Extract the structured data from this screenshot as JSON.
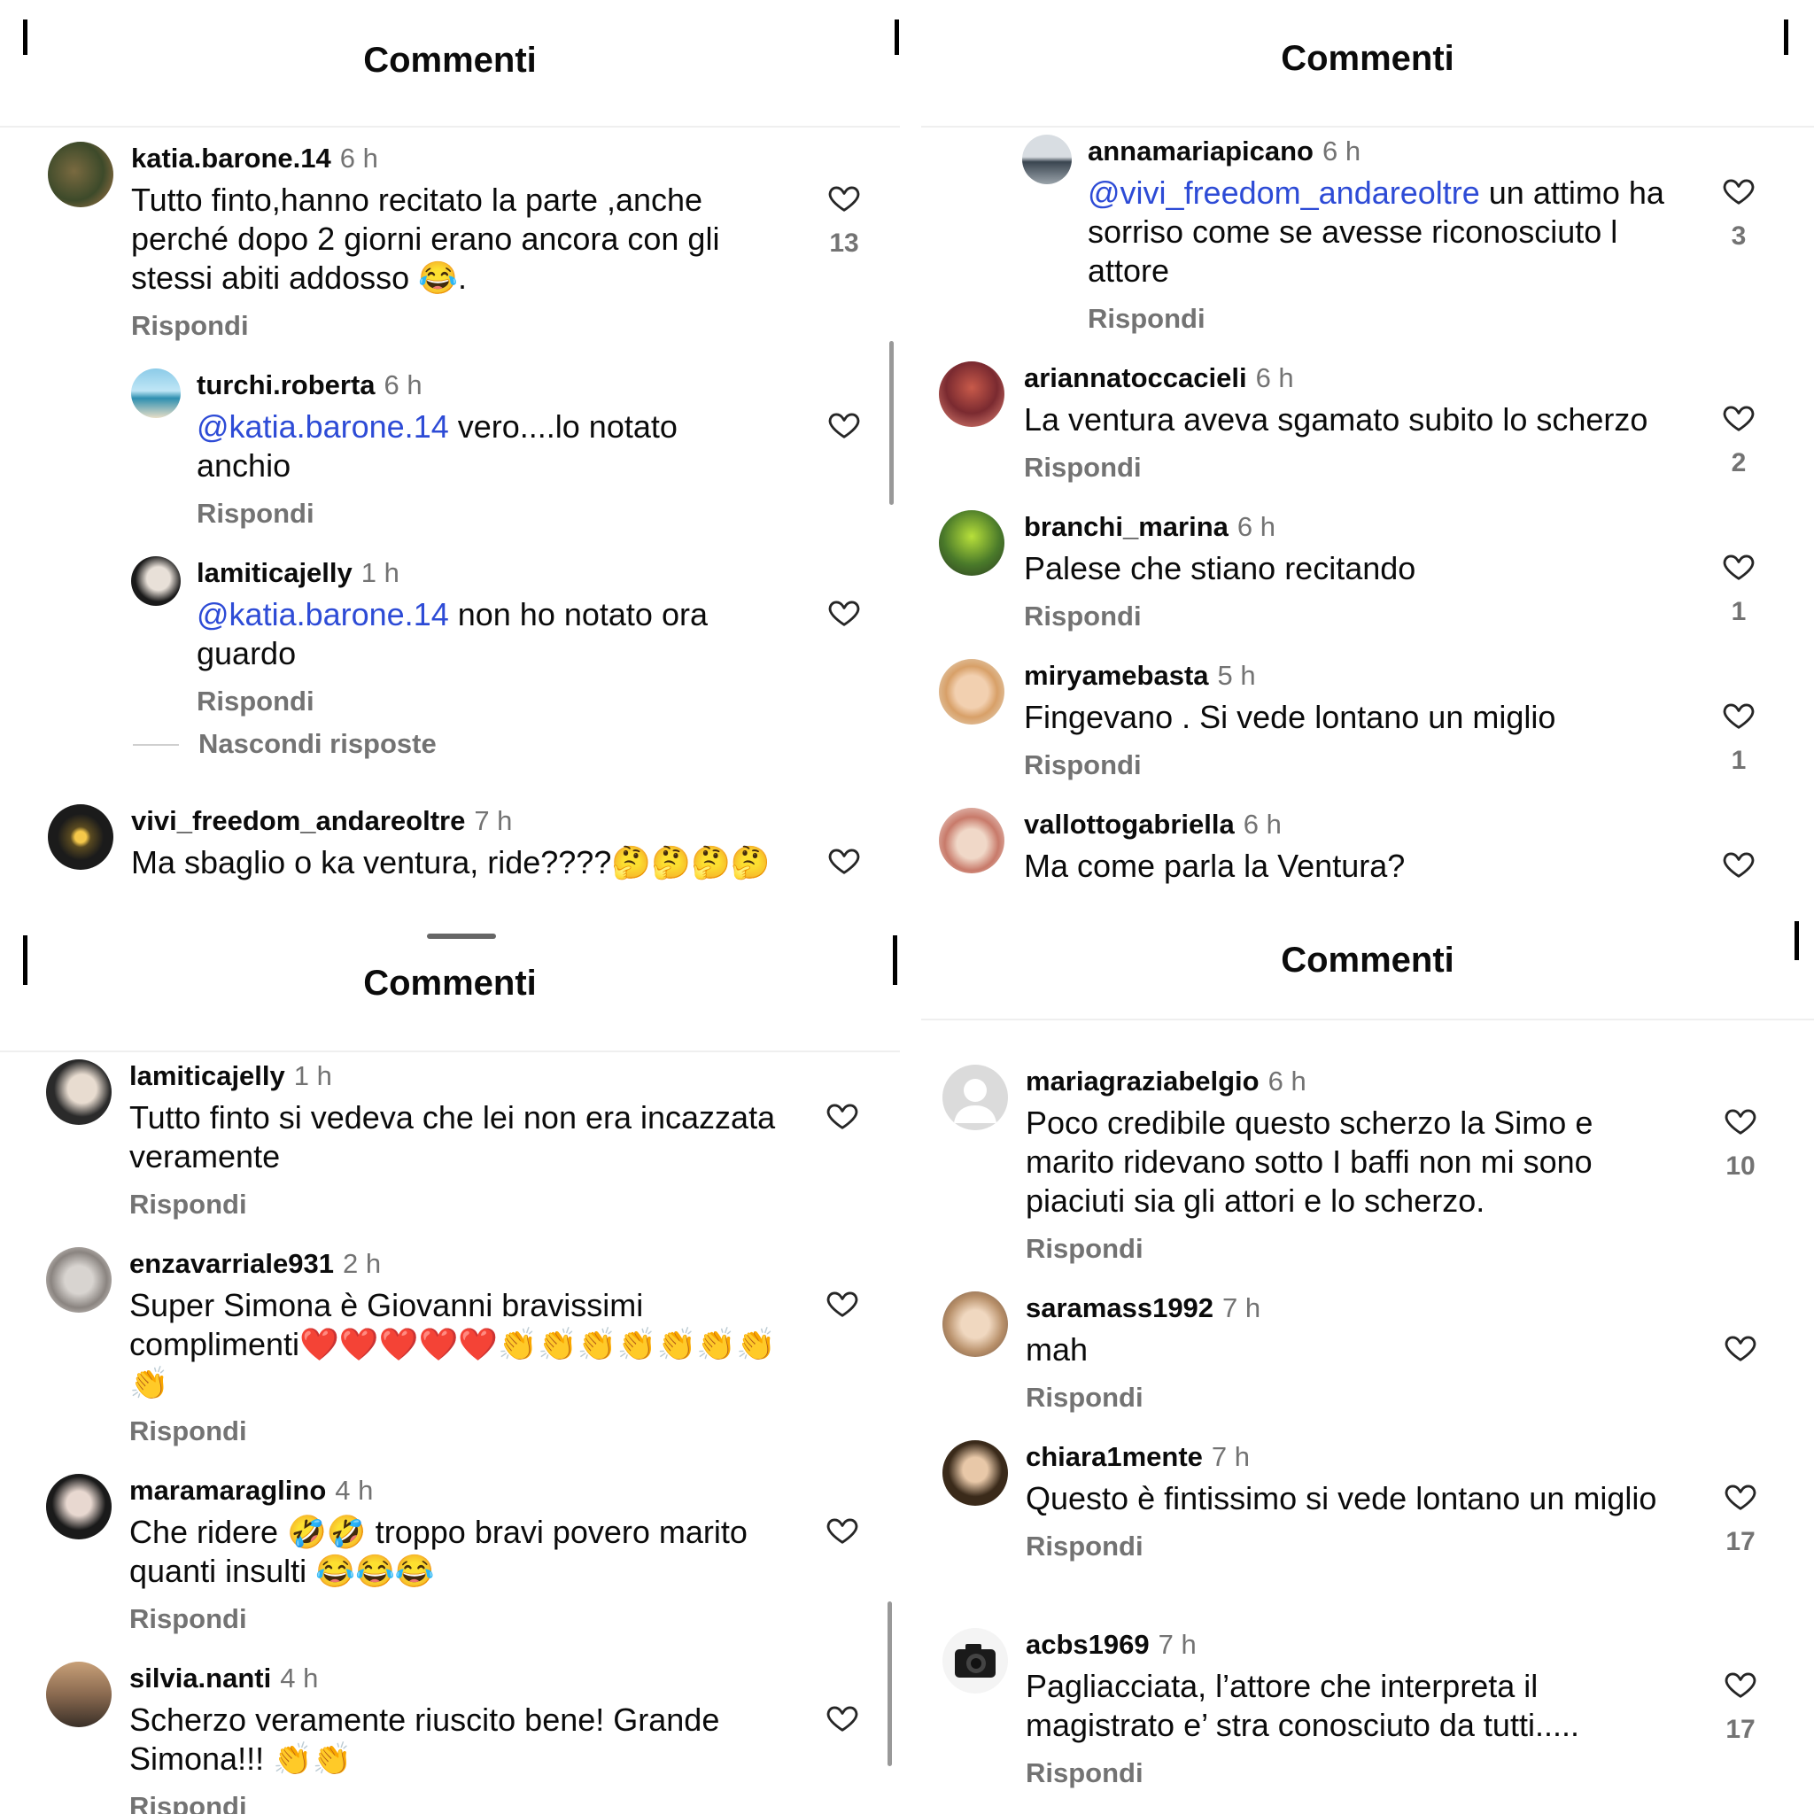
{
  "panels": [
    {
      "title": "Commenti",
      "comments": [
        {
          "user": "katia.barone.14",
          "time": "6 h",
          "text": "Tutto finto,hanno recitato la parte ,anche perché dopo 2 giorni erano ancora con gli stessi abiti addosso 😂.",
          "reply": "Rispondi",
          "likes": "13"
        },
        {
          "user": "turchi.roberta",
          "time": "6 h",
          "mention": "@katia.barone.14",
          "text": " vero....lo notato anchio",
          "reply": "Rispondi",
          "likes": ""
        },
        {
          "user": "lamiticajelly",
          "time": "1 h",
          "mention": "@katia.barone.14",
          "text": " non ho notato ora guardo",
          "reply": "Rispondi",
          "likes": ""
        },
        {
          "user": "vivi_freedom_andareoltre",
          "time": "7 h",
          "text": "Ma sbaglio o ka ventura, ride????🤔🤔🤔🤔",
          "reply": "",
          "likes": ""
        }
      ],
      "hide_replies": "Nascondi risposte"
    },
    {
      "title": "Commenti",
      "comments": [
        {
          "user": "annamariapicano",
          "time": "6 h",
          "mention": "@vivi_freedom_andareoltre",
          "text": " un attimo ha sorriso come se avesse riconosciuto l attore",
          "reply": "Rispondi",
          "likes": "3"
        },
        {
          "user": "ariannatoccacieli",
          "time": "6 h",
          "text": "La ventura aveva sgamato subito lo scherzo",
          "reply": "Rispondi",
          "likes": "2"
        },
        {
          "user": "branchi_marina",
          "time": "6 h",
          "text": "Palese che stiano recitando",
          "reply": "Rispondi",
          "likes": "1"
        },
        {
          "user": "miryamebasta",
          "time": "5 h",
          "text": "Fingevano . Si vede lontano un miglio",
          "reply": "Rispondi",
          "likes": "1"
        },
        {
          "user": "vallottogabriella",
          "time": "6 h",
          "text": "Ma come parla la Ventura?",
          "reply": "",
          "likes": ""
        }
      ]
    },
    {
      "title": "Commenti",
      "comments": [
        {
          "user": "lamiticajelly",
          "time": "1 h",
          "text": "Tutto finto si vedeva che lei non era incazzata veramente",
          "reply": "Rispondi",
          "likes": ""
        },
        {
          "user": "enzavarriale931",
          "time": "2 h",
          "text": "Super Simona è Giovanni bravissimi complimenti❤️❤️❤️❤️❤️👏👏👏👏👏👏👏👏",
          "reply": "Rispondi",
          "likes": ""
        },
        {
          "user": "maramaraglino",
          "time": "4 h",
          "text": "Che ridere 🤣🤣 troppo bravi povero marito quanti insulti 😂😂😂",
          "reply": "Rispondi",
          "likes": ""
        },
        {
          "user": "silvia.nanti",
          "time": "4 h",
          "text": "Scherzo veramente riuscito bene! Grande Simona!!! 👏👏",
          "reply": "Rispondi",
          "likes": ""
        }
      ]
    },
    {
      "title": "Commenti",
      "comments": [
        {
          "user": "mariagraziabelgio",
          "time": "6 h",
          "text": "Poco credibile questo scherzo la Simo e marito ridevano  sotto I baffi non mi sono piaciuti sia gli  attori e lo scherzo.",
          "reply": "Rispondi",
          "likes": "10"
        },
        {
          "user": "saramass1992",
          "time": "7 h",
          "text": "mah",
          "reply": "Rispondi",
          "likes": ""
        },
        {
          "user": "chiara1mente",
          "time": "7 h",
          "text": "Questo è fintissimo si vede lontano un miglio",
          "reply": "Rispondi",
          "likes": "17"
        },
        {
          "user": "acbs1969",
          "time": "7 h",
          "text": "Pagliacciata, l’attore che interpreta il magistrato e’ stra conosciuto da tutti.....",
          "reply": "Rispondi",
          "likes": "17"
        }
      ]
    }
  ],
  "colors": {
    "mention": "#2d4bd6",
    "muted": "#737373",
    "text": "#0b0b0b"
  },
  "icons": {
    "heart": "heart-icon",
    "avatar": "avatar"
  }
}
